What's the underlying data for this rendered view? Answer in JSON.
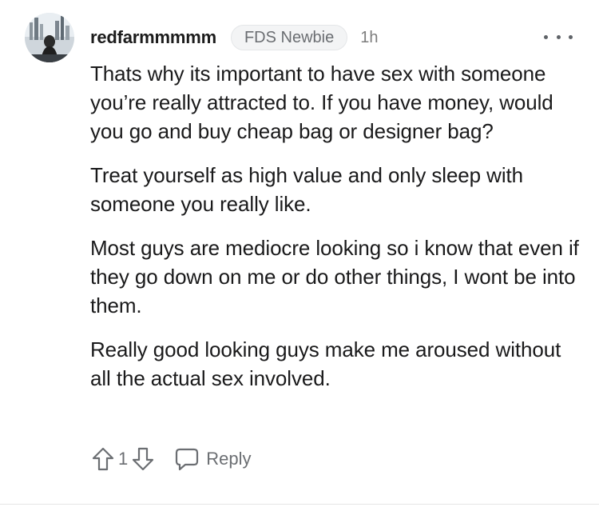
{
  "comment": {
    "username": "redfarmmmmm",
    "flair": "FDS Newbie",
    "timestamp": "1h",
    "paragraphs": [
      "Thats why its important to have sex with someone you’re really attracted to. If you have money, would you go and buy cheap bag or designer bag?",
      "Treat yourself as high value and only sleep with someone you really like.",
      "Most guys are mediocre looking so i know that even if they go down on me or do other things, I wont be into them.",
      "Really good looking guys make me aroused without all the actual sex involved."
    ],
    "score": "1",
    "reply_label": "Reply"
  },
  "icons": {
    "avatar": "avatar",
    "more": "more-horizontal-icon",
    "upvote": "upvote-arrow-icon",
    "downvote": "downvote-arrow-icon",
    "reply": "speech-bubble-icon"
  },
  "colors": {
    "text": "#1a1a1b",
    "muted": "#6b6e72",
    "flair_bg": "#f3f4f5"
  }
}
